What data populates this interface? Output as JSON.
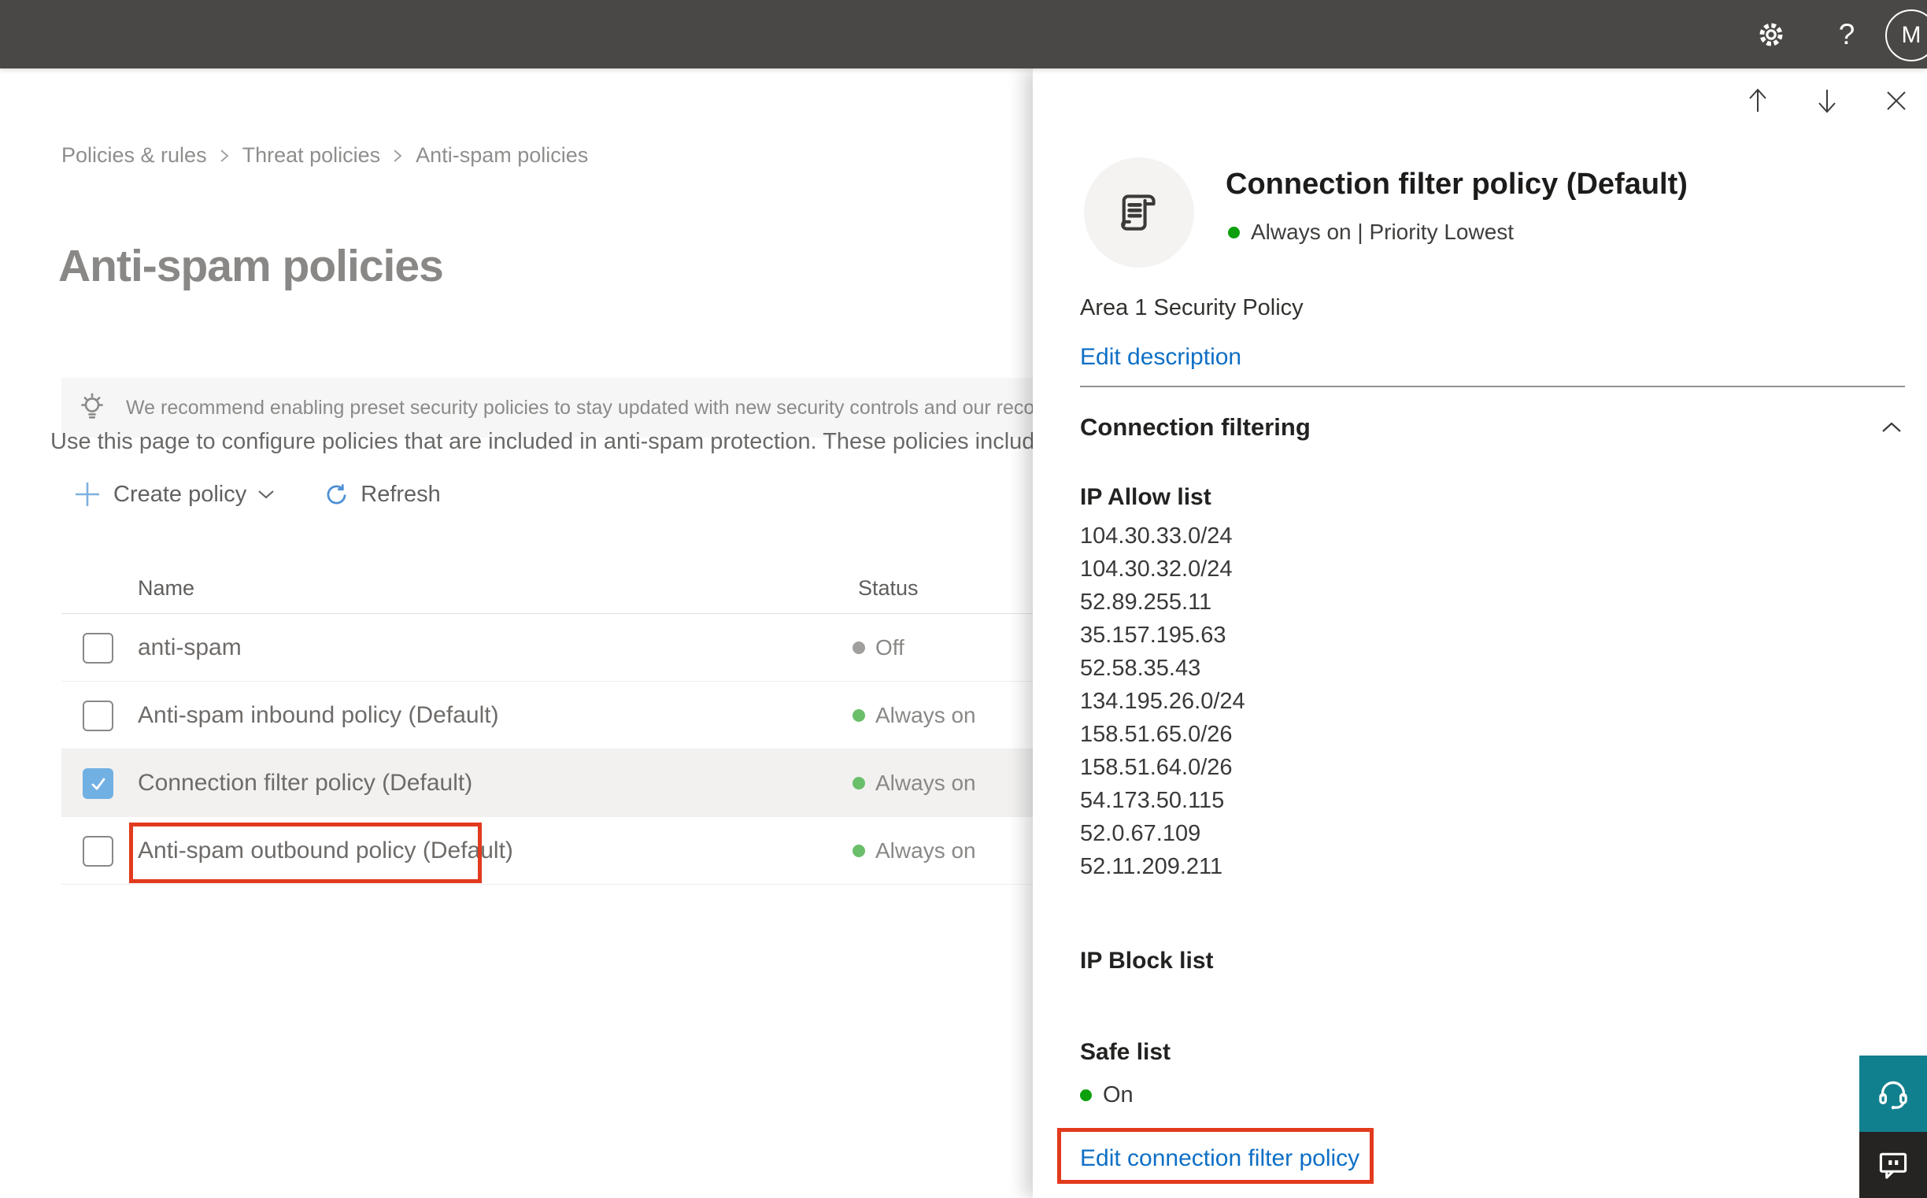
{
  "topbar": {
    "avatar_initial": "M"
  },
  "breadcrumb": {
    "items": [
      {
        "label": "Policies & rules"
      },
      {
        "label": "Threat policies"
      },
      {
        "label": "Anti-spam policies"
      }
    ]
  },
  "page": {
    "title": "Anti-spam policies",
    "banner": {
      "text": "We recommend enabling preset security policies to stay updated with new security controls and our recomme"
    },
    "intro": "Use this page to configure policies that are included in anti-spam protection. These policies include",
    "toolbar": {
      "create_policy_label": "Create policy",
      "refresh_label": "Refresh"
    }
  },
  "table": {
    "columns": {
      "name": "Name",
      "status": "Status"
    },
    "rows": [
      {
        "name": "anti-spam",
        "status": "Off",
        "status_dot": "gray",
        "checked": false,
        "selected": false,
        "annotated": false
      },
      {
        "name": "Anti-spam inbound policy (Default)",
        "status": "Always on",
        "status_dot": "green",
        "checked": false,
        "selected": false,
        "annotated": false
      },
      {
        "name": "Connection filter policy (Default)",
        "status": "Always on",
        "status_dot": "green",
        "checked": true,
        "selected": true,
        "annotated": true
      },
      {
        "name": "Anti-spam outbound policy (Default)",
        "status": "Always on",
        "status_dot": "green",
        "checked": false,
        "selected": false,
        "annotated": false
      }
    ]
  },
  "panel": {
    "title": "Connection filter policy (Default)",
    "status_line": "Always on | Priority Lowest",
    "description": "Area 1 Security Policy",
    "edit_description_label": "Edit description",
    "section": {
      "title": "Connection filtering"
    },
    "ip_allow": {
      "title": "IP Allow list",
      "ips": [
        "104.30.33.0/24",
        "104.30.32.0/24",
        "52.89.255.11",
        "35.157.195.63",
        "52.58.35.43",
        "134.195.26.0/24",
        "158.51.65.0/26",
        "158.51.64.0/26",
        "54.173.50.115",
        "52.0.67.109",
        "52.11.209.211"
      ]
    },
    "ip_block": {
      "title": "IP Block list"
    },
    "safe_list": {
      "title": "Safe list",
      "status": "On"
    },
    "edit_policy_label": "Edit connection filter policy"
  },
  "colors": {
    "topbar_bg": "#4a4846",
    "accent_blue": "#0e6fc5",
    "status_green_soft": "#6abf6a",
    "status_green_bright": "#0da00d",
    "status_gray": "#a19f9d",
    "annotation_red": "#e23a1d",
    "support_teal": "#11808e",
    "checkbox_blue": "#71b0e3"
  }
}
